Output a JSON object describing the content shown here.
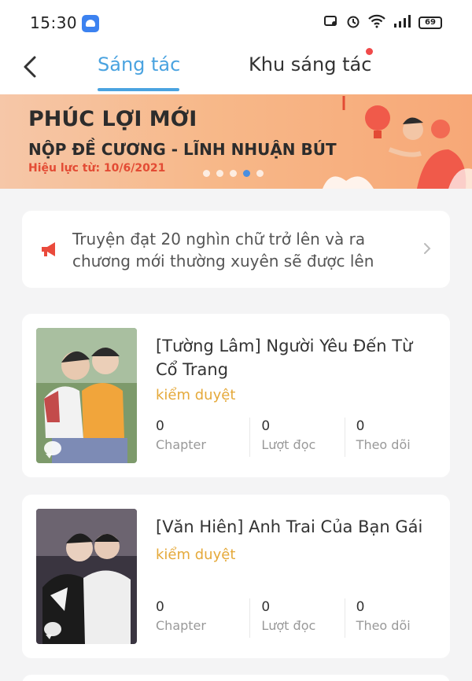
{
  "status_bar": {
    "time": "15:30",
    "battery": "69",
    "icons": [
      "app-icon",
      "screen-record-icon",
      "alarm-icon",
      "wifi-icon",
      "signal-icon",
      "battery-icon"
    ]
  },
  "header": {
    "tab_active": "Sáng tác",
    "tab_other": "Khu sáng tác"
  },
  "banner": {
    "title": "PHÚC LỢI MỚI",
    "subtitle": "NỘP ĐỀ CƯƠNG - LĨNH NHUẬN BÚT",
    "date": "Hiệu lực từ: 10/6/2021",
    "slides": 5,
    "active_slide": 4
  },
  "notice": {
    "text": "Truyện đạt 20 nghìn chữ trở lên và ra chương mới thường xuyên sẽ được lên"
  },
  "stories": [
    {
      "title": "[Tường Lâm] Người Yêu Đến Từ Cổ Trang",
      "status": "kiểm duyệt",
      "stats": [
        {
          "value": "0",
          "label": "Chapter"
        },
        {
          "value": "0",
          "label": "Lượt đọc"
        },
        {
          "value": "0",
          "label": "Theo dõi"
        }
      ]
    },
    {
      "title": "[Văn Hiên] Anh Trai Của Bạn Gái",
      "status": "kiểm duyệt",
      "stats": [
        {
          "value": "0",
          "label": "Chapter"
        },
        {
          "value": "0",
          "label": "Lượt đọc"
        },
        {
          "value": "0",
          "label": "Theo dõi"
        }
      ]
    }
  ],
  "colors": {
    "accent": "#4aa3e0",
    "status": "#e5a93a",
    "badge": "#f04a4a"
  }
}
